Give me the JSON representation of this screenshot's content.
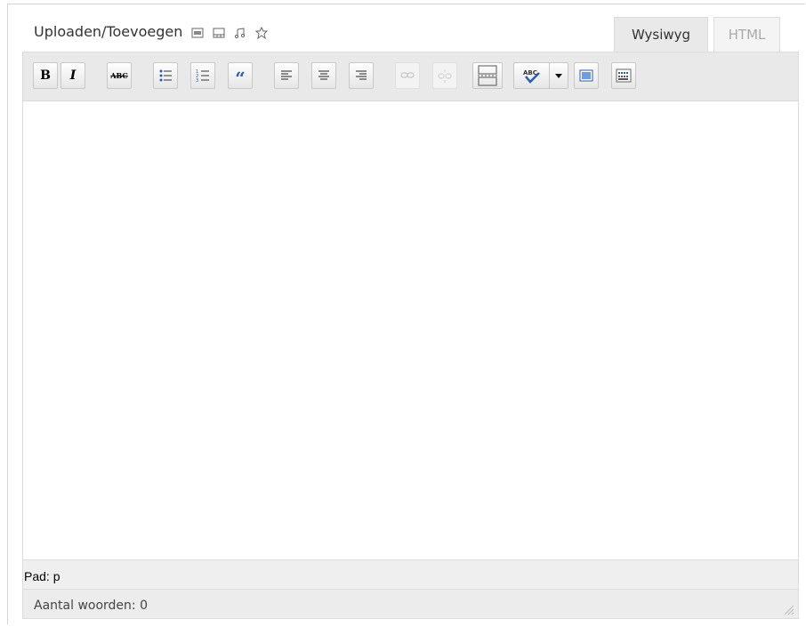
{
  "media": {
    "label": "Uploaden/Toevoegen",
    "icons": [
      "add-image-icon",
      "add-video-icon",
      "add-audio-icon",
      "add-media-icon"
    ]
  },
  "tabs": {
    "visual": "Wysiwyg",
    "html": "HTML",
    "active": "Wysiwyg"
  },
  "toolbar": {
    "buttons": [
      {
        "icon": "bold-icon",
        "glyph": "B"
      },
      {
        "icon": "italic-icon",
        "glyph": "I"
      },
      {
        "icon": "strikethrough-icon",
        "glyph": "ABC"
      },
      {
        "icon": "bullet-list-icon"
      },
      {
        "icon": "numbered-list-icon"
      },
      {
        "icon": "blockquote-icon",
        "glyph": "“"
      },
      {
        "icon": "align-left-icon"
      },
      {
        "icon": "align-center-icon"
      },
      {
        "icon": "align-right-icon"
      },
      {
        "icon": "link-icon",
        "disabled": true
      },
      {
        "icon": "unlink-icon",
        "disabled": true
      },
      {
        "icon": "more-tag-icon"
      },
      {
        "icon": "spellcheck-icon",
        "glyph": "ABC"
      },
      {
        "icon": "dropdown-arrow-icon"
      },
      {
        "icon": "fullscreen-icon"
      },
      {
        "icon": "kitchen-sink-icon"
      }
    ]
  },
  "status": {
    "path": "Pad: p",
    "wordcount": "Aantal woorden: 0"
  },
  "colors": {
    "toolbar_bg": "#e9e9e9",
    "border": "#dcdcdc",
    "blue_icon": "#2a5db0"
  }
}
